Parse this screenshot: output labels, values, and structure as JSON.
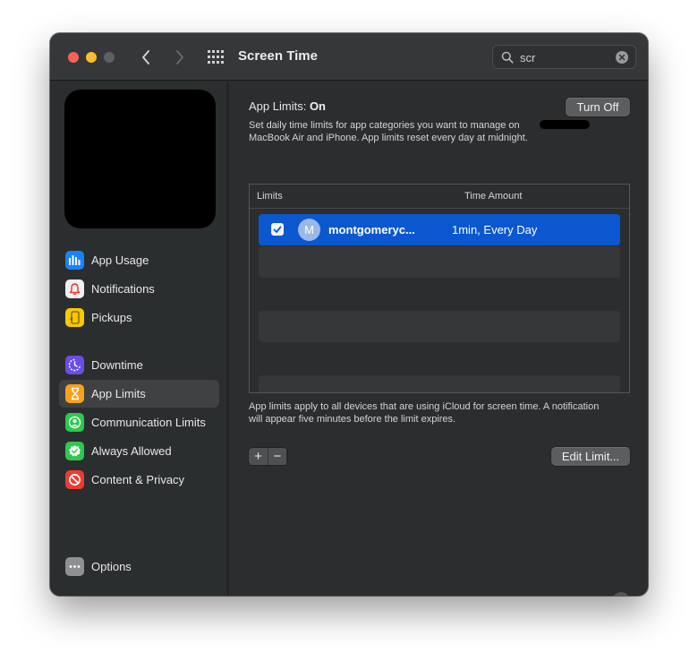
{
  "window": {
    "title": "Screen Time"
  },
  "search": {
    "value": "scr"
  },
  "sidebar": {
    "items": [
      {
        "label": "App Usage",
        "icon": "bar-chart-icon",
        "color": "#1a82fb"
      },
      {
        "label": "Notifications",
        "icon": "bell-icon",
        "color": "#f0f0f0"
      },
      {
        "label": "Pickups",
        "icon": "pickup-icon",
        "color": "#f7c900"
      },
      {
        "label": "Downtime",
        "icon": "downtime-icon",
        "color": "#6b4de6"
      },
      {
        "label": "App Limits",
        "icon": "hourglass-icon",
        "color": "#f7a21b",
        "selected": true
      },
      {
        "label": "Communication Limits",
        "icon": "person-icon",
        "color": "#2ec84e"
      },
      {
        "label": "Always Allowed",
        "icon": "checkmark-shield-icon",
        "color": "#2ec84e"
      },
      {
        "label": "Content & Privacy",
        "icon": "prohibited-icon",
        "color": "#ee3b30"
      }
    ],
    "options_label": "Options"
  },
  "main": {
    "header_label": "App Limits:",
    "header_status": "On",
    "turn_off_label": "Turn Off",
    "description_line1": "Set daily time limits for app categories you want to manage on",
    "description_line2": "MacBook Air and iPhone. App limits reset every day at midnight.",
    "table": {
      "col_limits": "Limits",
      "col_time": "Time Amount",
      "rows": [
        {
          "avatar_letter": "M",
          "name": "montgomeryc...",
          "time": "1min, Every Day",
          "checked": true
        }
      ]
    },
    "footer_line1": "App limits apply to all devices that are using iCloud for screen time. A notification",
    "footer_line2": "will appear five minutes before the limit expires.",
    "add_label": "+",
    "remove_label": "−",
    "edit_label": "Edit Limit...",
    "help_label": "?"
  },
  "colors": {
    "accent": "#0b57d0",
    "window_bg": "#2b2d2e"
  }
}
